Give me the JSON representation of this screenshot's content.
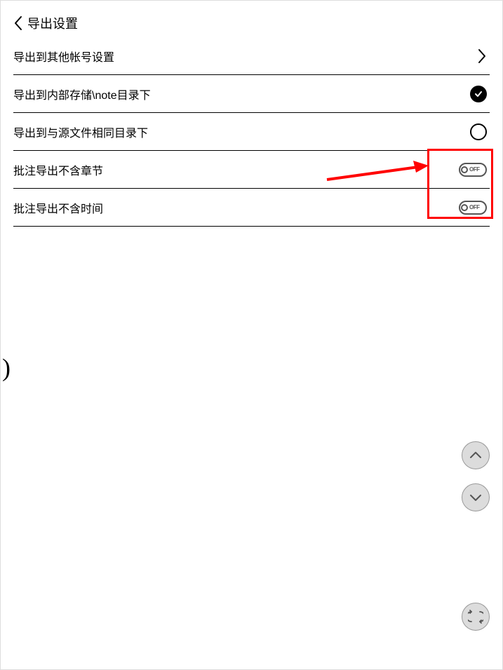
{
  "header": {
    "title": "导出设置"
  },
  "rows": {
    "account": {
      "label": "导出到其他帐号设置"
    },
    "internal": {
      "label": "导出到内部存储\\note目录下"
    },
    "same_dir": {
      "label": "导出到与源文件相同目录下"
    },
    "no_chapter": {
      "label": "批注导出不含章节",
      "toggle": "OFF"
    },
    "no_time": {
      "label": "批注导出不含时间",
      "toggle": "OFF"
    }
  },
  "stray": ")"
}
